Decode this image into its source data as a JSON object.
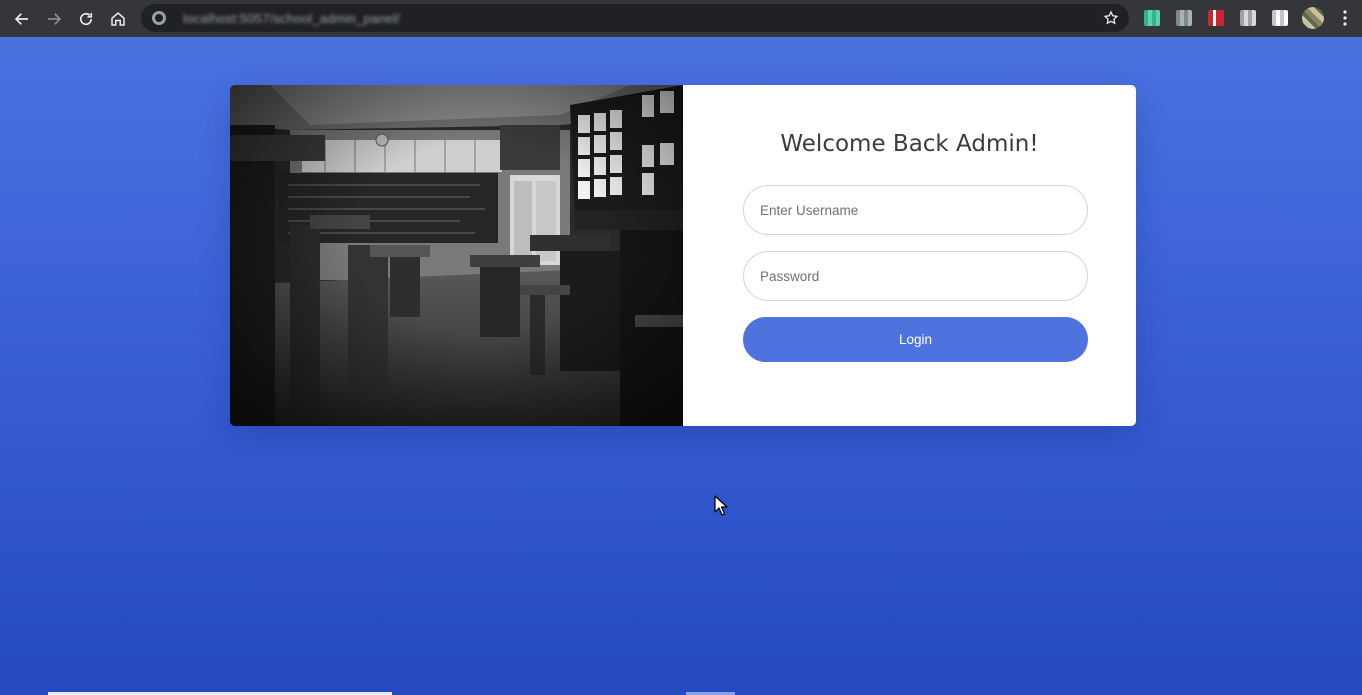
{
  "browser": {
    "url": "localhost:5057/school_admin_panel/",
    "icons": {
      "back": "arrow-left-icon",
      "forward": "arrow-right-icon",
      "reload": "reload-icon",
      "home": "home-icon",
      "lock": "site-info-icon",
      "bookmark": "star-icon",
      "menu": "kebab-menu-icon"
    }
  },
  "login": {
    "heading": "Welcome Back Admin!",
    "username_placeholder": "Enter Username",
    "username_value": "",
    "password_placeholder": "Password",
    "password_value": "",
    "login_label": "Login"
  },
  "colors": {
    "primary": "#4e73df",
    "background_top": "#4a72df",
    "background_bottom": "#2449c0",
    "chrome": "#35363a"
  }
}
